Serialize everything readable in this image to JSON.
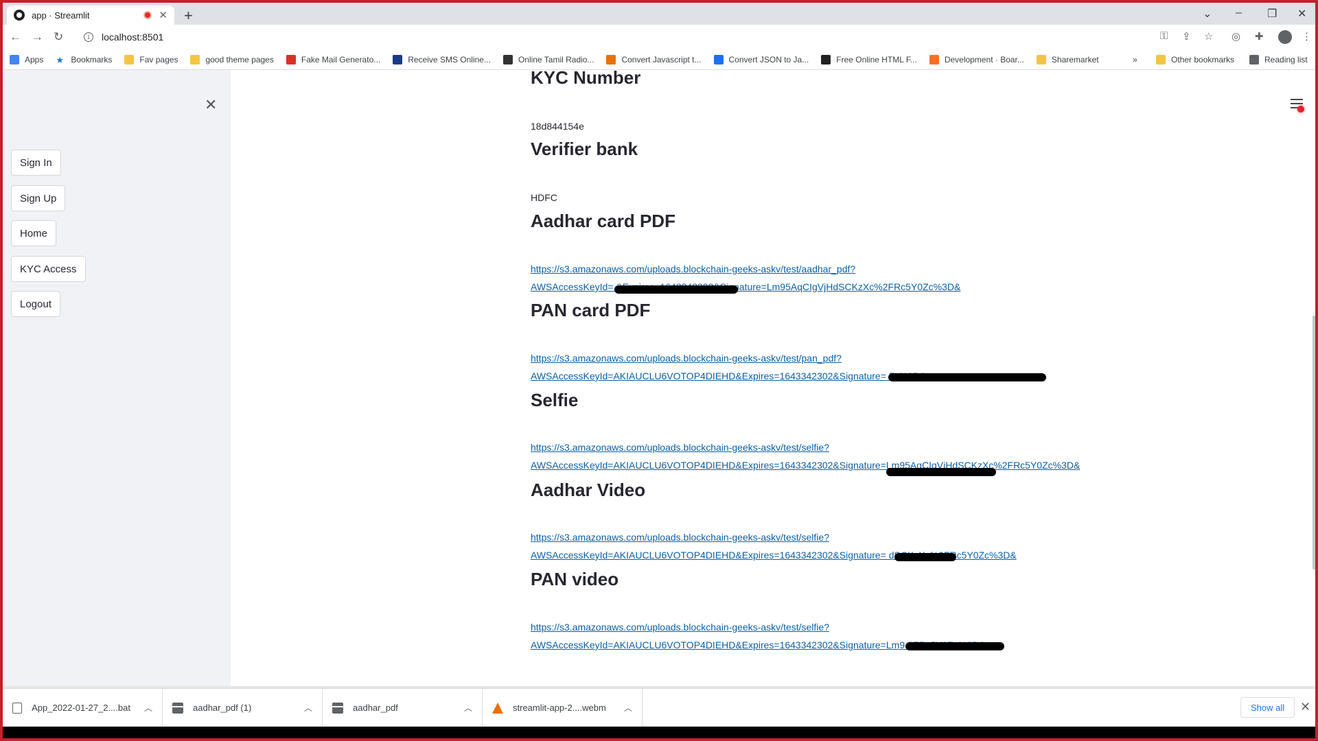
{
  "browser": {
    "tab_title": "app · Streamlit",
    "url": "localhost:8501",
    "bookmarks": [
      {
        "label": "Apps",
        "icon": "apps-grid-icon",
        "color": "#4285f4"
      },
      {
        "label": "Bookmarks",
        "icon": "star-icon",
        "color": "#1a73e8"
      },
      {
        "label": "Fav pages",
        "icon": "folder-icon",
        "color": "#f4c542"
      },
      {
        "label": "good theme pages",
        "icon": "folder-icon",
        "color": "#f4c542"
      },
      {
        "label": "Fake Mail Generato...",
        "icon": "mail-icon",
        "color": "#d93025"
      },
      {
        "label": "Receive SMS Online...",
        "icon": "sms-icon",
        "color": "#1a3a8a"
      },
      {
        "label": "Online Tamil Radio...",
        "icon": "speaker-icon",
        "color": "#333333"
      },
      {
        "label": "Convert Javascript t...",
        "icon": "convert-icon",
        "color": "#e8710a"
      },
      {
        "label": "Convert JSON to Ja...",
        "icon": "c-icon",
        "color": "#1a73e8"
      },
      {
        "label": "Free Online HTML F...",
        "icon": "ff-icon",
        "color": "#222222"
      },
      {
        "label": "Development · Boar...",
        "icon": "gitlab-icon",
        "color": "#fc6d26"
      },
      {
        "label": "Sharemarket",
        "icon": "folder-icon",
        "color": "#f4c542"
      }
    ],
    "other_bookmarks": "Other bookmarks",
    "reading_list": "Reading list",
    "overflow": "»"
  },
  "sidebar": {
    "buttons": [
      "Sign In",
      "Sign Up",
      "Home",
      "KYC Access",
      "Logout"
    ]
  },
  "main": {
    "kyc_number": {
      "heading": "KYC Number",
      "value": "18d844154e"
    },
    "verifier_bank": {
      "heading": "Verifier bank",
      "value": "HDFC"
    },
    "aadhar_pdf": {
      "heading": "Aadhar card PDF",
      "line1": "https://s3.amazonaws.com/uploads.blockchain-geeks-askv/test/aadhar_pdf?",
      "line2": "AWSAccessKeyId=                                        &Expires=1643342302&Signature=Lm95AqCIgVjHdSCKzXc%2FRc5Y0Zc%3D&"
    },
    "pan_pdf": {
      "heading": "PAN card PDF",
      "line1": "https://s3.amazonaws.com/uploads.blockchain-geeks-askv/test/pan_pdf?",
      "line2": "AWSAccessKeyId=AKIAUCLU6VOTOP4DIEHD&Expires=1643342302&Signature=                                                7c%3D&"
    },
    "selfie": {
      "heading": "Selfie",
      "line1": "https://s3.amazonaws.com/uploads.blockchain-geeks-askv/test/selfie?",
      "line2": "AWSAccessKeyId=AKIAUCLU6VOTOP4DIEHD&Expires=1643342302&Signature=Lm95AqCIgVjHdSCKzXc%2FRc5Y0Zc%3D&"
    },
    "aadhar_video": {
      "heading": "Aadhar Video",
      "line1": "https://s3.amazonaws.com/uploads.blockchain-geeks-askv/test/selfie?",
      "line2": "AWSAccessKeyId=AKIAUCLU6VOTOP4DIEHD&Expires=1643342302&Signature=                    dSCKzXc%2FRc5Y0Zc%3D&"
    },
    "pan_video": {
      "heading": "PAN video",
      "line1": "https://s3.amazonaws.com/uploads.blockchain-geeks-askv/test/selfie?",
      "line2": "AWSAccessKeyId=AKIAUCLU6VOTOP4DIEHD&Expires=1643342302&Signature=Lm9                         2FRc5Y0Zc%3D&"
    }
  },
  "downloads": {
    "items": [
      "App_2022-01-27_2....bat",
      "aadhar_pdf (1)",
      "aadhar_pdf",
      "streamlit-app-2....webm"
    ],
    "show_all": "Show all"
  }
}
